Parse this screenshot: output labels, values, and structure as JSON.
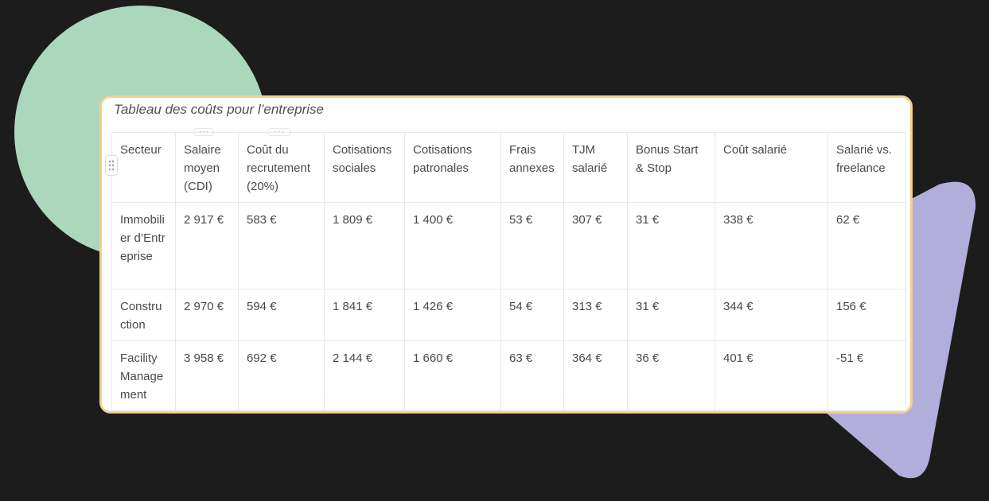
{
  "colors": {
    "background": "#1c1c1c",
    "circle": "#abd7bd",
    "shape": "#b1aedb",
    "card_border": "#f5cf8e",
    "card_bg": "#ffffff",
    "text": "#4a4a4a"
  },
  "table": {
    "caption": "Tableau des coûts pour l’entreprise",
    "headers": [
      "Secteur",
      "Salaire moyen (CDI)",
      "Coût du recrutement (20%)",
      "Cotisations sociales",
      "Cotisations patronales",
      "Frais annexes",
      "TJM salarié",
      "Bonus Start & Stop",
      "Coût salarié",
      "Salarié vs. freelance"
    ],
    "rows": [
      [
        "Immobilier d’Entreprise",
        "2 917 €",
        "583 €",
        "1 809 €",
        "1 400 €",
        "53 €",
        "307 €",
        "31 €",
        "338 €",
        "62 €"
      ],
      [
        "Construction",
        "2 970 €",
        "594 €",
        "1 841 €",
        "1 426 €",
        "54 €",
        "313 €",
        "31 €",
        "344 €",
        "156 €"
      ],
      [
        "Facility Management",
        "3 958 €",
        "692 €",
        "2 144 €",
        "1 660 €",
        "63 €",
        "364 €",
        "36 €",
        "401 €",
        "-51 €"
      ]
    ]
  },
  "icons": {
    "row_handle": "drag-handle-icon",
    "column_handle": "more-horizontal-icon"
  }
}
